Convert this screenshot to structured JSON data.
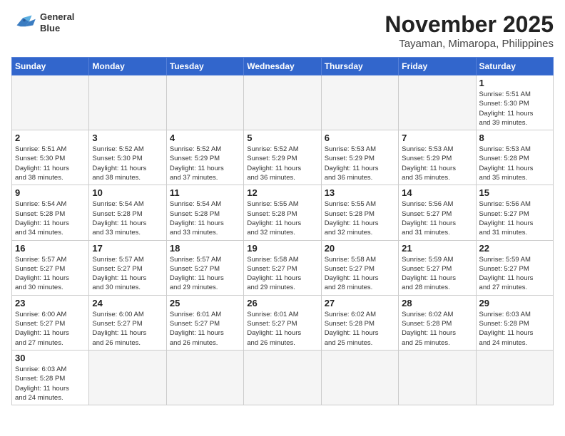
{
  "header": {
    "logo_line1": "General",
    "logo_line2": "Blue",
    "month": "November 2025",
    "location": "Tayaman, Mimaropa, Philippines"
  },
  "weekdays": [
    "Sunday",
    "Monday",
    "Tuesday",
    "Wednesday",
    "Thursday",
    "Friday",
    "Saturday"
  ],
  "weeks": [
    [
      {
        "day": "",
        "info": ""
      },
      {
        "day": "",
        "info": ""
      },
      {
        "day": "",
        "info": ""
      },
      {
        "day": "",
        "info": ""
      },
      {
        "day": "",
        "info": ""
      },
      {
        "day": "",
        "info": ""
      },
      {
        "day": "1",
        "info": "Sunrise: 5:51 AM\nSunset: 5:30 PM\nDaylight: 11 hours\nand 39 minutes."
      }
    ],
    [
      {
        "day": "2",
        "info": "Sunrise: 5:51 AM\nSunset: 5:30 PM\nDaylight: 11 hours\nand 38 minutes."
      },
      {
        "day": "3",
        "info": "Sunrise: 5:52 AM\nSunset: 5:30 PM\nDaylight: 11 hours\nand 38 minutes."
      },
      {
        "day": "4",
        "info": "Sunrise: 5:52 AM\nSunset: 5:29 PM\nDaylight: 11 hours\nand 37 minutes."
      },
      {
        "day": "5",
        "info": "Sunrise: 5:52 AM\nSunset: 5:29 PM\nDaylight: 11 hours\nand 36 minutes."
      },
      {
        "day": "6",
        "info": "Sunrise: 5:53 AM\nSunset: 5:29 PM\nDaylight: 11 hours\nand 36 minutes."
      },
      {
        "day": "7",
        "info": "Sunrise: 5:53 AM\nSunset: 5:29 PM\nDaylight: 11 hours\nand 35 minutes."
      },
      {
        "day": "8",
        "info": "Sunrise: 5:53 AM\nSunset: 5:28 PM\nDaylight: 11 hours\nand 35 minutes."
      }
    ],
    [
      {
        "day": "9",
        "info": "Sunrise: 5:54 AM\nSunset: 5:28 PM\nDaylight: 11 hours\nand 34 minutes."
      },
      {
        "day": "10",
        "info": "Sunrise: 5:54 AM\nSunset: 5:28 PM\nDaylight: 11 hours\nand 33 minutes."
      },
      {
        "day": "11",
        "info": "Sunrise: 5:54 AM\nSunset: 5:28 PM\nDaylight: 11 hours\nand 33 minutes."
      },
      {
        "day": "12",
        "info": "Sunrise: 5:55 AM\nSunset: 5:28 PM\nDaylight: 11 hours\nand 32 minutes."
      },
      {
        "day": "13",
        "info": "Sunrise: 5:55 AM\nSunset: 5:28 PM\nDaylight: 11 hours\nand 32 minutes."
      },
      {
        "day": "14",
        "info": "Sunrise: 5:56 AM\nSunset: 5:27 PM\nDaylight: 11 hours\nand 31 minutes."
      },
      {
        "day": "15",
        "info": "Sunrise: 5:56 AM\nSunset: 5:27 PM\nDaylight: 11 hours\nand 31 minutes."
      }
    ],
    [
      {
        "day": "16",
        "info": "Sunrise: 5:57 AM\nSunset: 5:27 PM\nDaylight: 11 hours\nand 30 minutes."
      },
      {
        "day": "17",
        "info": "Sunrise: 5:57 AM\nSunset: 5:27 PM\nDaylight: 11 hours\nand 30 minutes."
      },
      {
        "day": "18",
        "info": "Sunrise: 5:57 AM\nSunset: 5:27 PM\nDaylight: 11 hours\nand 29 minutes."
      },
      {
        "day": "19",
        "info": "Sunrise: 5:58 AM\nSunset: 5:27 PM\nDaylight: 11 hours\nand 29 minutes."
      },
      {
        "day": "20",
        "info": "Sunrise: 5:58 AM\nSunset: 5:27 PM\nDaylight: 11 hours\nand 28 minutes."
      },
      {
        "day": "21",
        "info": "Sunrise: 5:59 AM\nSunset: 5:27 PM\nDaylight: 11 hours\nand 28 minutes."
      },
      {
        "day": "22",
        "info": "Sunrise: 5:59 AM\nSunset: 5:27 PM\nDaylight: 11 hours\nand 27 minutes."
      }
    ],
    [
      {
        "day": "23",
        "info": "Sunrise: 6:00 AM\nSunset: 5:27 PM\nDaylight: 11 hours\nand 27 minutes."
      },
      {
        "day": "24",
        "info": "Sunrise: 6:00 AM\nSunset: 5:27 PM\nDaylight: 11 hours\nand 26 minutes."
      },
      {
        "day": "25",
        "info": "Sunrise: 6:01 AM\nSunset: 5:27 PM\nDaylight: 11 hours\nand 26 minutes."
      },
      {
        "day": "26",
        "info": "Sunrise: 6:01 AM\nSunset: 5:27 PM\nDaylight: 11 hours\nand 26 minutes."
      },
      {
        "day": "27",
        "info": "Sunrise: 6:02 AM\nSunset: 5:28 PM\nDaylight: 11 hours\nand 25 minutes."
      },
      {
        "day": "28",
        "info": "Sunrise: 6:02 AM\nSunset: 5:28 PM\nDaylight: 11 hours\nand 25 minutes."
      },
      {
        "day": "29",
        "info": "Sunrise: 6:03 AM\nSunset: 5:28 PM\nDaylight: 11 hours\nand 24 minutes."
      }
    ],
    [
      {
        "day": "30",
        "info": "Sunrise: 6:03 AM\nSunset: 5:28 PM\nDaylight: 11 hours\nand 24 minutes."
      },
      {
        "day": "",
        "info": ""
      },
      {
        "day": "",
        "info": ""
      },
      {
        "day": "",
        "info": ""
      },
      {
        "day": "",
        "info": ""
      },
      {
        "day": "",
        "info": ""
      },
      {
        "day": "",
        "info": ""
      }
    ]
  ]
}
